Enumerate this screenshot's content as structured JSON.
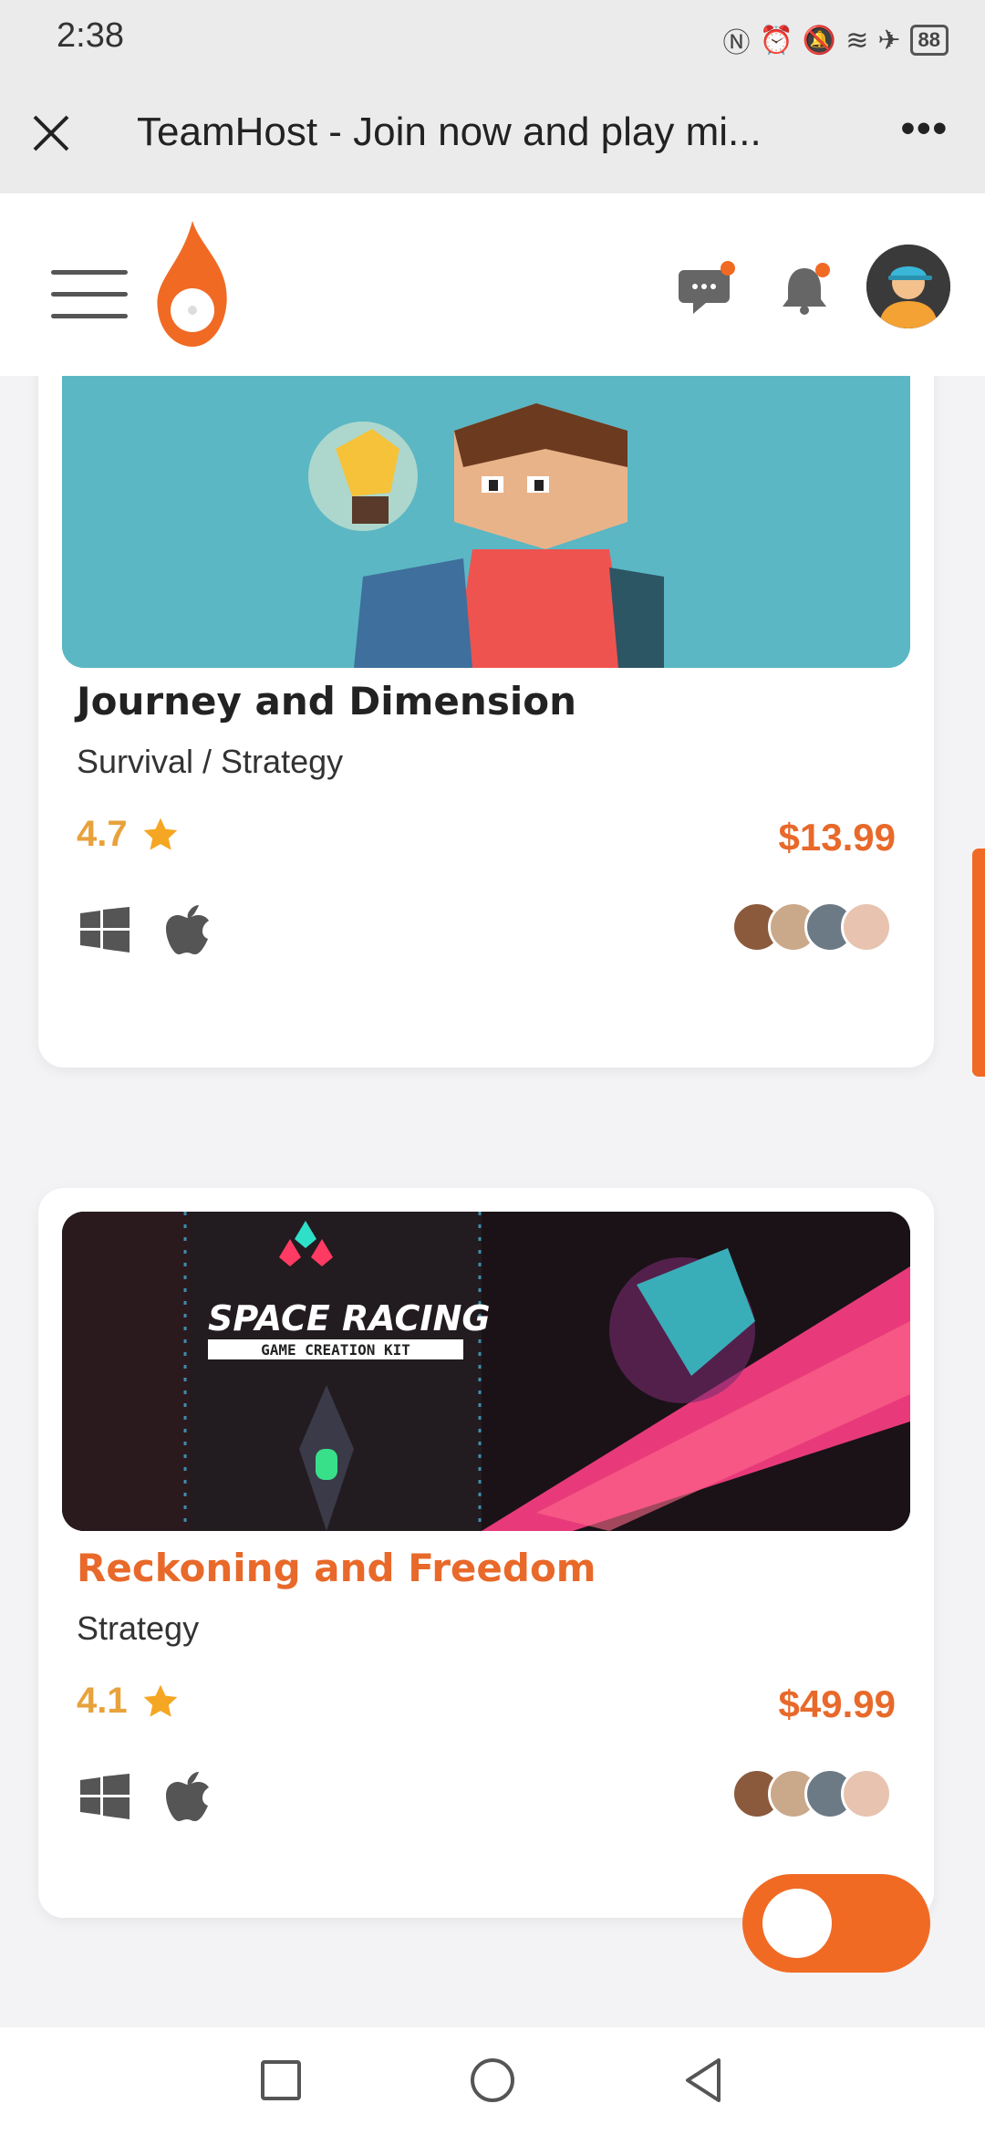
{
  "status": {
    "time": "2:38",
    "battery": "88"
  },
  "browser": {
    "title": "TeamHost - Join now and play mi..."
  },
  "cards": [
    {
      "title": "Journey and Dimension",
      "genre": "Survival / Strategy",
      "rating": "4.7",
      "price": "$13.99"
    },
    {
      "title": "Reckoning and Freedom",
      "genre": "Strategy",
      "rating": "4.1",
      "price": "$49.99",
      "image_title": "SPACE RACING",
      "image_subtitle": "GAME CREATION KIT"
    }
  ],
  "colors": {
    "accent": "#f06a24",
    "rating": "#e8a23c",
    "price": "#e8692a"
  },
  "icons": [
    "close-icon",
    "more-icon",
    "menu-icon",
    "logo",
    "chat-icon",
    "bell-icon",
    "windows-icon",
    "apple-icon",
    "star-icon"
  ]
}
